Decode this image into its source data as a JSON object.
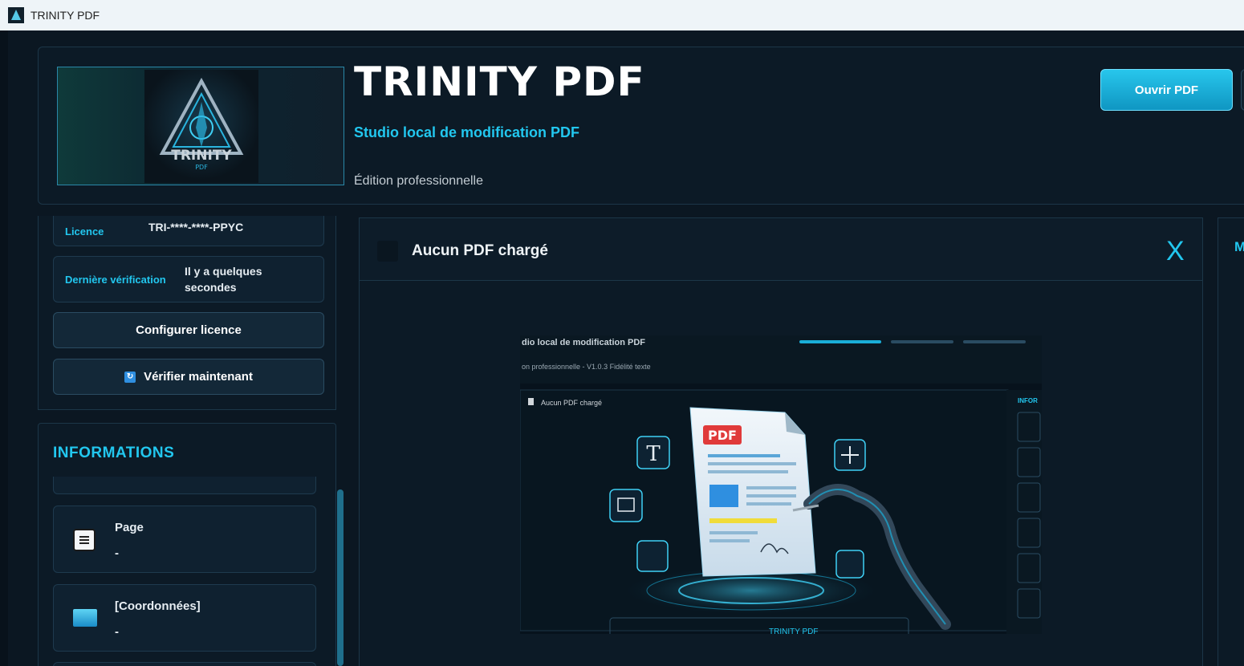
{
  "window": {
    "title": "TRINITY PDF"
  },
  "header": {
    "logo_text": "TRINITY",
    "logo_subtext": "PDF",
    "title": "TRINITY PDF",
    "subtitle": "Studio local de modification PDF",
    "edition": "Édition professionnelle",
    "open_button": "Ouvrir PDF"
  },
  "license": {
    "licence_label": "Licence",
    "licence_value": "TRI-****-****-PPYC",
    "last_check_label": "Dernière vérification",
    "last_check_value": "Il y a quelques secondes",
    "configure_button": "Configurer licence",
    "verify_button": "Vérifier maintenant"
  },
  "info": {
    "title": "INFORMATIONS",
    "items": [
      {
        "label": "Page",
        "value": "-",
        "icon": "page-list-icon"
      },
      {
        "label": "[Coordonnées]",
        "value": "-",
        "icon": "coordinates-icon"
      }
    ]
  },
  "viewer": {
    "status": "Aucun PDF chargé",
    "close_label": "X",
    "preview": {
      "subtitle_fragment": "dio local de modification PDF",
      "edition_fragment": "on professionnelle - V1.0.3 Fidélité texte",
      "doc_status": "Aucun PDF chargé",
      "pdf_badge": "PDF",
      "side_label": "INFOR",
      "bottom_fragment": "TRINITY PDF"
    }
  },
  "right_panel": {
    "title_fragment": "M"
  },
  "colors": {
    "accent": "#22c7ef",
    "background": "#0b1722",
    "panel": "#0c1a26",
    "button": "#1aaed8"
  }
}
